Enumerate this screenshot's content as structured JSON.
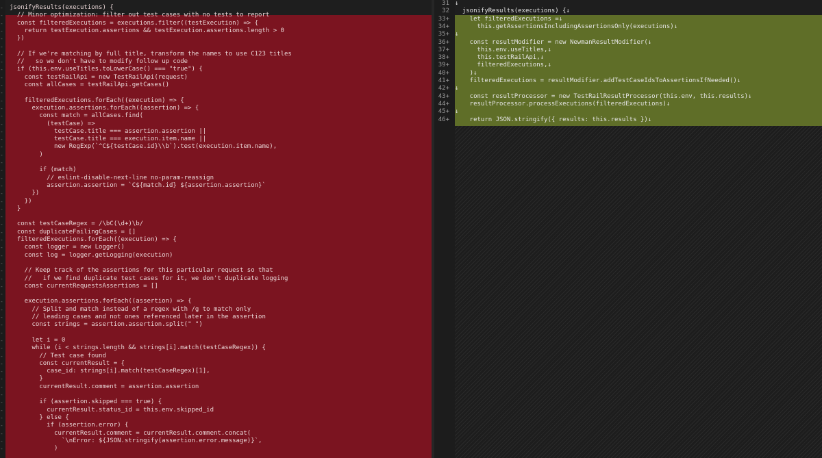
{
  "left_pane": {
    "lines": [
      "jsonifyResults(executions) {",
      "  // Minor optimization: filter out test cases with no tests to report",
      "  const filteredExecutions = executions.filter((testExecution) => {",
      "    return testExecution.assertions && testExecution.assertions.length > 0",
      "  })",
      "",
      "  // If we're matching by full title, transform the names to use C123 titles",
      "  //   so we don't have to modify follow up code",
      "  if (this.env.useTitles.toLowerCase() === \"true\") {",
      "    const testRailApi = new TestRailApi(request)",
      "    const allCases = testRailApi.getCases()",
      "",
      "    filteredExecutions.forEach((execution) => {",
      "      execution.assertions.forEach((assertion) => {",
      "        const match = allCases.find(",
      "          (testCase) =>",
      "            testCase.title === assertion.assertion ||",
      "            testCase.title === execution.item.name ||",
      "            new RegExp(`^C${testCase.id}\\\\b`).test(execution.item.name),",
      "        )",
      "",
      "        if (match)",
      "          // eslint-disable-next-line no-param-reassign",
      "          assertion.assertion = `C${match.id} ${assertion.assertion}`",
      "      })",
      "    })",
      "  }",
      "",
      "  const testCaseRegex = /\\bC(\\d+)\\b/",
      "  const duplicateFailingCases = []",
      "  filteredExecutions.forEach((execution) => {",
      "    const logger = new Logger()",
      "    const log = logger.getLogging(execution)",
      "",
      "    // Keep track of the assertions for this particular request so that",
      "    //   if we find duplicate test cases for it, we don't duplicate logging",
      "    const currentRequestsAssertions = []",
      "",
      "    execution.assertions.forEach((assertion) => {",
      "      // Split and match instead of a regex with /g to match only",
      "      // leading cases and not ones referenced later in the assertion",
      "      const strings = assertion.assertion.split(\" \")",
      "",
      "      let i = 0",
      "      while (i < strings.length && strings[i].match(testCaseRegex)) {",
      "        // Test case found",
      "        const currentResult = {",
      "          case_id: strings[i].match(testCaseRegex)[1],",
      "        }",
      "        currentResult.comment = assertion.assertion",
      "",
      "        if (assertion.skipped === true) {",
      "          currentResult.status_id = this.env.skipped_id",
      "        } else {",
      "          if (assertion.error) {",
      "            currentResult.comment = currentResult.comment.concat(",
      "              `\\nError: ${JSON.stringify(assertion.error.message)}`,",
      "            )"
    ]
  },
  "right_pane": {
    "lines": [
      {
        "num": "31",
        "text": "↓"
      },
      {
        "num": "32",
        "text": "  jsonifyResults(executions) {↓"
      },
      {
        "num": "33+",
        "text": "    let filteredExecutions =↓"
      },
      {
        "num": "34+",
        "text": "      this.getAssertionsIncludingAssertionsOnly(executions)↓"
      },
      {
        "num": "35+",
        "text": "↓"
      },
      {
        "num": "36+",
        "text": "    const resultModifier = new NewmanResultModifier(↓"
      },
      {
        "num": "37+",
        "text": "      this.env.useTitles,↓"
      },
      {
        "num": "38+",
        "text": "      this.testRailApi,↓"
      },
      {
        "num": "39+",
        "text": "      filteredExecutions,↓"
      },
      {
        "num": "40+",
        "text": "    )↓"
      },
      {
        "num": "41+",
        "text": "    filteredExecutions = resultModifier.addTestCaseIdsToAssertionsIfNeeded()↓"
      },
      {
        "num": "42+",
        "text": "↓"
      },
      {
        "num": "43+",
        "text": "    const resultProcessor = new TestRailResultProcessor(this.env, this.results)↓"
      },
      {
        "num": "44+",
        "text": "    resultProcessor.processExecutions(filteredExecutions)↓"
      },
      {
        "num": "45+",
        "text": "↓"
      },
      {
        "num": "46+",
        "text": "    return JSON.stringify({ results: this.results })↓"
      }
    ]
  },
  "colors": {
    "removed_bg": "#7b1420",
    "added_bg": "#5f6e28",
    "editor_bg": "#1e1e1e"
  }
}
